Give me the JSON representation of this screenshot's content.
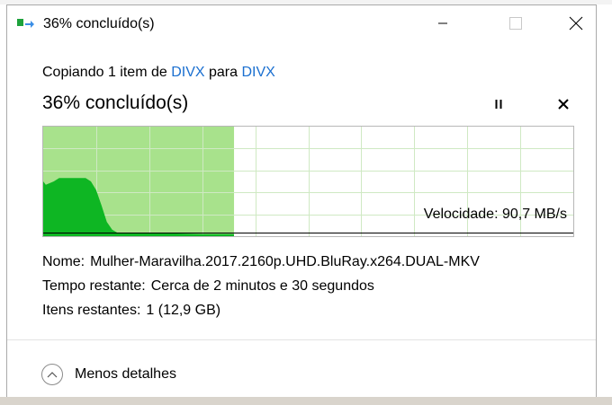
{
  "window": {
    "title": "36% concluído(s)",
    "minimize_icon": "minimize-icon",
    "maximize_icon": "maximize-icon",
    "close_icon": "close-icon"
  },
  "copy": {
    "prefix": "Copiando 1 item de ",
    "source": "DIVX",
    "middle": " para ",
    "destination": "DIVX",
    "link_color": "#1a6fd0"
  },
  "progress": {
    "title": "36% concluído(s)",
    "percent": 36,
    "pause_icon": "pause-icon",
    "cancel_icon": "cancel-icon",
    "fill_color": "#a8e28c",
    "speed_color": "#0eb623"
  },
  "chart_data": {
    "type": "area",
    "title": "",
    "xlabel": "",
    "ylabel": "",
    "speed_label": "Velocidade: 90,7 MB/s",
    "progress_fraction": 0.36,
    "current_speed_fraction": 0.02,
    "series": [
      {
        "x": [
          0.0,
          0.005,
          0.02,
          0.03,
          0.04,
          0.05,
          0.06,
          0.07,
          0.08,
          0.09,
          0.1,
          0.11,
          0.12,
          0.13,
          0.14,
          0.16,
          0.2,
          0.25,
          0.3,
          0.36
        ],
        "values": [
          0.5,
          0.47,
          0.5,
          0.53,
          0.53,
          0.53,
          0.53,
          0.53,
          0.53,
          0.5,
          0.42,
          0.28,
          0.13,
          0.06,
          0.03,
          0.025,
          0.03,
          0.025,
          0.02,
          0.02
        ]
      }
    ],
    "grid": true
  },
  "details": {
    "name_label": "Nome:",
    "name_value": "Mulher-Maravilha.2017.2160p.UHD.BluRay.x264.DUAL-MKV",
    "time_label": "Tempo restante:",
    "time_value": "Cerca de 2 minutos e 30 segundos",
    "items_label": "Itens restantes:",
    "items_value": "1 (12,9 GB)"
  },
  "footer": {
    "less_details": "Menos detalhes",
    "collapse_icon": "chevron-up-icon"
  }
}
